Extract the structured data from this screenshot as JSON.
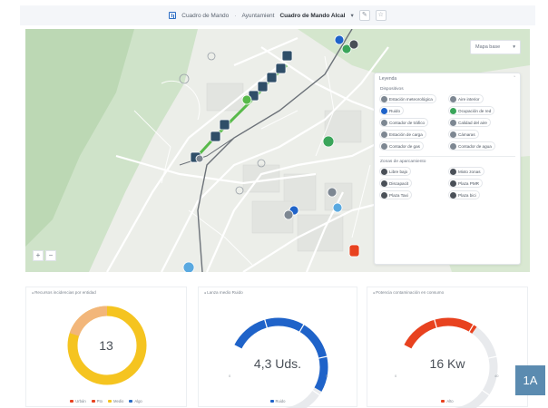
{
  "colors": {
    "accent_blue": "#2b6cc4",
    "route_green": "#58b94a",
    "route_dark": "#2f4e68",
    "donut_yellow": "#f5c420",
    "donut_orange": "#f2b67a",
    "gauge_blue": "#1f63c9",
    "gauge_red": "#e8421f",
    "track_grey": "#e8eaed"
  },
  "header": {
    "icon": "dashboard-icon",
    "title": "Cuadro de Mando",
    "separator": "·",
    "org": "Ayuntamient",
    "current": "Cuadro de Mando Alcal",
    "dropdown_glyph": "▾",
    "edit_glyph": "✎",
    "extra_glyph": "☆"
  },
  "map": {
    "map_type": "Mapa base",
    "map_type_glyph": "▾",
    "zoom_in": "+",
    "zoom_out": "−"
  },
  "legend": {
    "title": "Leyenda",
    "collapse_glyph": "ˇ",
    "section_devices": "Dispositivos",
    "devices": [
      {
        "label": "Estación meteorológica",
        "icon": "weather-station-icon",
        "color": "#7d8792"
      },
      {
        "label": "Aire interior",
        "icon": "air-icon",
        "color": "#7d8792"
      },
      {
        "label": "Ruido",
        "icon": "noise-icon",
        "color": "#1f63c9"
      },
      {
        "label": "Ocupación de red",
        "icon": "network-icon",
        "color": "#3aa55a"
      },
      {
        "label": "Contador de tráfico",
        "icon": "traffic-counter-icon",
        "color": "#7d8792"
      },
      {
        "label": "Calidad del aire",
        "icon": "air-quality-icon",
        "color": "#7d8792"
      },
      {
        "label": "Estación de carga",
        "icon": "charging-icon",
        "color": "#7d8792"
      },
      {
        "label": "Cámaras",
        "icon": "camera-icon",
        "color": "#7d8792"
      },
      {
        "label": "Contador de gas",
        "icon": "gas-meter-icon",
        "color": "#7d8792"
      },
      {
        "label": "Contador de agua",
        "icon": "water-meter-icon",
        "color": "#7d8792"
      }
    ],
    "section_places": "Zonas de aparcamiento",
    "places": [
      {
        "label": "Libre bajo",
        "icon": "parking-low-icon",
        "color": "#4a5058"
      },
      {
        "label": "Mixto zonas",
        "icon": "parking-mixed-icon",
        "color": "#4a5058"
      },
      {
        "label": "Discapacit",
        "icon": "parking-disabled-icon",
        "color": "#4a5058"
      },
      {
        "label": "Plaza PMR",
        "icon": "parking-pmr-icon",
        "color": "#4a5058"
      },
      {
        "label": "Plaza Taxi",
        "icon": "parking-taxi-icon",
        "color": "#4a5058"
      },
      {
        "label": "Plaza bici",
        "icon": "parking-bike-icon",
        "color": "#4a5058"
      }
    ]
  },
  "cards": [
    {
      "title": "Recursos incidencias por entidad",
      "type": "donut",
      "center_value": "13",
      "legend": [
        {
          "label": "Urbán",
          "color": "#e8421f"
        },
        {
          "label": "Pto",
          "color": "#e8421f"
        },
        {
          "label": "Medio",
          "color": "#f5c420"
        },
        {
          "label": "Algo",
          "color": "#2b6cc4"
        }
      ]
    },
    {
      "title": "Lanza medio Ruido",
      "type": "gauge",
      "value_text": "4,3 Uds.",
      "fraction": 0.78,
      "min_label": "0",
      "max_label": "5",
      "legend": [
        {
          "label": "Ruido",
          "color": "#1f63c9"
        }
      ]
    },
    {
      "title": "Potencia contaminación en consumo",
      "type": "gauge",
      "value_text": "16 Kw",
      "fraction": 0.42,
      "min_label": "0",
      "max_label": "40",
      "legend": [
        {
          "label": "Alto",
          "color": "#e8421f"
        }
      ]
    }
  ],
  "badge": "1A"
}
